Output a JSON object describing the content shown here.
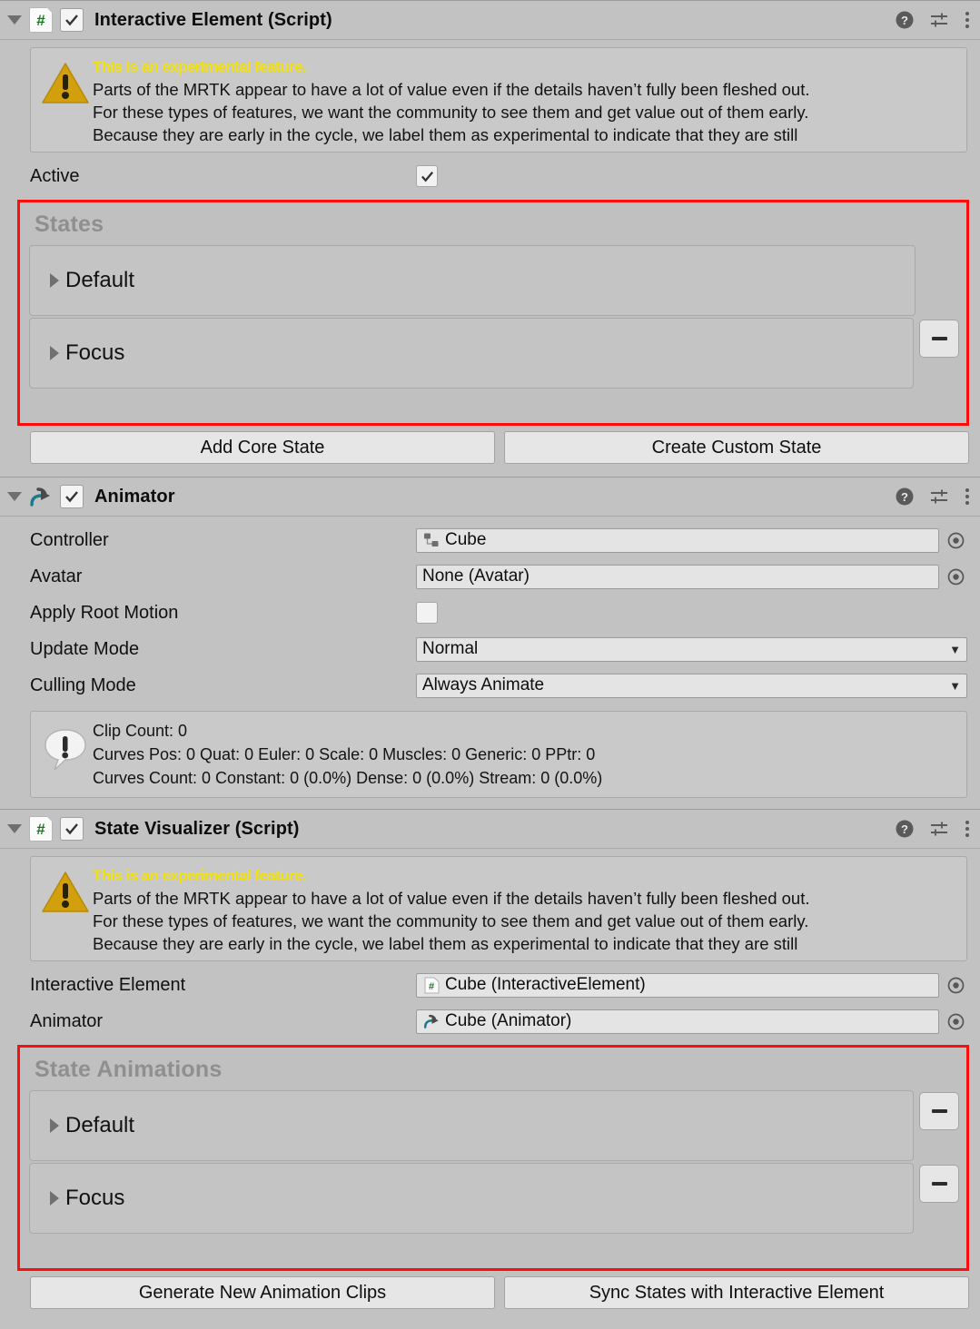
{
  "experimental_warning": {
    "title": "This is an experimental feature.",
    "line1": "Parts of the MRTK appear to have a lot of value even if the details haven’t fully been fleshed out.",
    "line2": "For these types of features, we want the community to see them and get value out of them early.",
    "line3": "Because they are early in the cycle, we label them as experimental to indicate that they are still",
    "icon": "warning-triangle-icon",
    "title_color": "#f2e10c",
    "icon_color": "#d2a00c"
  },
  "header_icons": {
    "help": "help-icon",
    "preset": "preset-settings-icon",
    "menu": "more-menu-icon",
    "foldout": "foldout-triangle-icon"
  },
  "interactive_element": {
    "title": "Interactive Element (Script)",
    "script_glyph": "#",
    "enabled": true,
    "active_label": "Active",
    "active_checked": true,
    "states": {
      "title": "States",
      "highlight_color": "#fd0d0d",
      "items": [
        {
          "name": "Default",
          "removable": false
        },
        {
          "name": "Focus",
          "removable": true
        }
      ]
    },
    "buttons": {
      "add_core_state": "Add Core State",
      "create_custom_state": "Create Custom State"
    }
  },
  "animator": {
    "title": "Animator",
    "enabled": true,
    "icon": "animator-icon",
    "fields": [
      {
        "label": "Controller",
        "value": "Cube",
        "type": "object",
        "icon": "animator-controller-icon"
      },
      {
        "label": "Avatar",
        "value": "None (Avatar)",
        "type": "object",
        "icon": ""
      },
      {
        "label": "Apply Root Motion",
        "value": "",
        "type": "checkbox",
        "checked": false
      },
      {
        "label": "Update Mode",
        "value": "Normal",
        "type": "dropdown"
      },
      {
        "label": "Culling Mode",
        "value": "Always Animate",
        "type": "dropdown"
      }
    ],
    "info": {
      "icon": "info-speech-icon",
      "line1": "Clip Count: 0",
      "line2": "Curves Pos: 0 Quat: 0 Euler: 0 Scale: 0 Muscles: 0 Generic: 0 PPtr: 0",
      "line3": "Curves Count: 0 Constant: 0 (0.0%) Dense: 0 (0.0%) Stream: 0 (0.0%)"
    }
  },
  "state_visualizer": {
    "title": "State Visualizer (Script)",
    "script_glyph": "#",
    "enabled": true,
    "fields": [
      {
        "label": "Interactive Element",
        "value": "Cube (InteractiveElement)",
        "icon": "script-icon"
      },
      {
        "label": "Animator",
        "value": "Cube (Animator)",
        "icon": "animator-icon"
      }
    ],
    "state_animations": {
      "title": "State Animations",
      "highlight_color": "#fd0d0d",
      "items": [
        {
          "name": "Default",
          "removable": true
        },
        {
          "name": "Focus",
          "removable": true
        }
      ]
    },
    "buttons": {
      "generate_clips": "Generate New Animation Clips",
      "sync_states": "Sync States with Interactive Element"
    }
  }
}
